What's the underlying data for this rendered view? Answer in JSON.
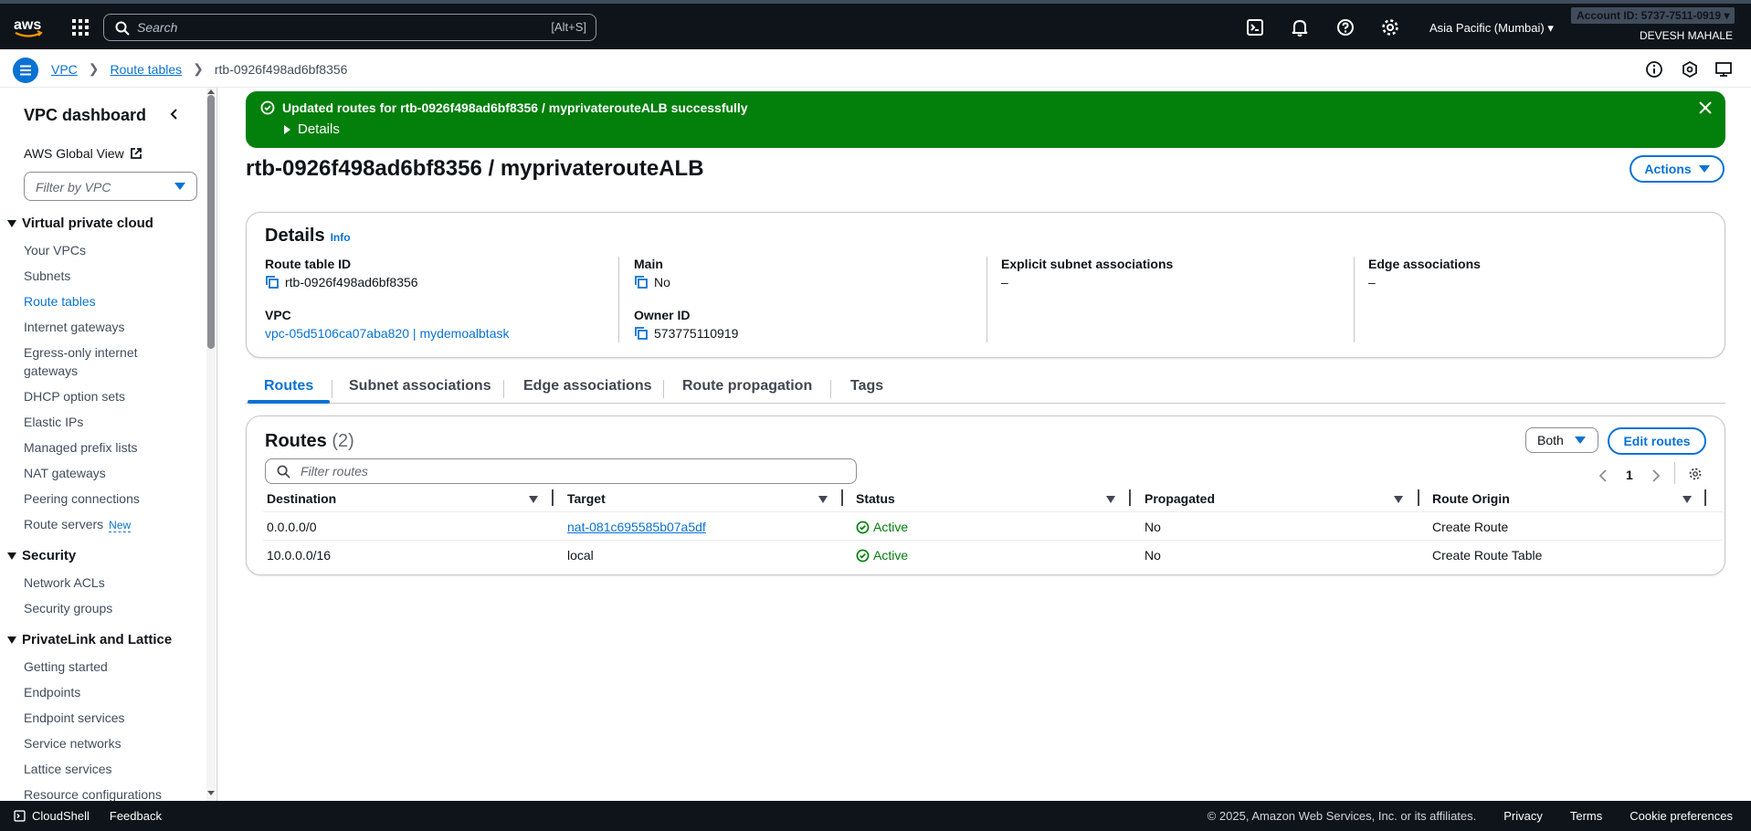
{
  "topnav": {
    "search_placeholder": "Search",
    "search_shortcut": "[Alt+S]",
    "region": "Asia Pacific (Mumbai)",
    "account_label": "Account ID: 5737-7511-0919",
    "username": "DEVESH MAHALE"
  },
  "breadcrumb": {
    "items": [
      "VPC",
      "Route tables"
    ],
    "current": "rtb-0926f498ad6bf8356"
  },
  "sidebar": {
    "title": "VPC dashboard",
    "global_view": "AWS Global View",
    "filter_placeholder": "Filter by VPC",
    "sections": [
      {
        "title": "Virtual private cloud",
        "items": [
          "Your VPCs",
          "Subnets",
          "Route tables",
          "Internet gateways",
          "Egress-only internet gateways",
          "DHCP option sets",
          "Elastic IPs",
          "Managed prefix lists",
          "NAT gateways",
          "Peering connections",
          "Route servers"
        ]
      },
      {
        "title": "Security",
        "items": [
          "Network ACLs",
          "Security groups"
        ]
      },
      {
        "title": "PrivateLink and Lattice",
        "items": [
          "Getting started",
          "Endpoints",
          "Endpoint services",
          "Service networks",
          "Lattice services",
          "Resource configurations"
        ]
      }
    ],
    "new_badge": "New"
  },
  "flash": {
    "message": "Updated routes for rtb-0926f498ad6bf8356 / myprivaterouteALB successfully",
    "details_label": "Details"
  },
  "page": {
    "title": "rtb-0926f498ad6bf8356 / myprivaterouteALB",
    "actions_label": "Actions"
  },
  "details": {
    "title": "Details",
    "info": "Info",
    "route_table_id_label": "Route table ID",
    "route_table_id": "rtb-0926f498ad6bf8356",
    "main_label": "Main",
    "main": "No",
    "explicit_label": "Explicit subnet associations",
    "explicit": "–",
    "edge_label": "Edge associations",
    "edge": "–",
    "vpc_label": "VPC",
    "vpc": "vpc-05d5106ca07aba820 | mydemoalbtask",
    "owner_label": "Owner ID",
    "owner": "573775110919"
  },
  "tabs": [
    "Routes",
    "Subnet associations",
    "Edge associations",
    "Route propagation",
    "Tags"
  ],
  "routes": {
    "title": "Routes",
    "count": "(2)",
    "filter_placeholder": "Filter routes",
    "both_label": "Both",
    "edit_label": "Edit routes",
    "page": "1",
    "columns": [
      "Destination",
      "Target",
      "Status",
      "Propagated",
      "Route Origin"
    ],
    "rows": [
      {
        "destination": "0.0.0.0/0",
        "target": "nat-081c695585b07a5df",
        "status": "Active",
        "propagated": "No",
        "origin": "Create Route"
      },
      {
        "destination": "10.0.0.0/16",
        "target": "local",
        "status": "Active",
        "propagated": "No",
        "origin": "Create Route Table"
      }
    ]
  },
  "footer": {
    "cloudshell": "CloudShell",
    "feedback": "Feedback",
    "copyright": "© 2025, Amazon Web Services, Inc. or its affiliates.",
    "privacy": "Privacy",
    "terms": "Terms",
    "cookies": "Cookie preferences"
  },
  "colors": {
    "nav_bg": "#0f141a",
    "link": "#0972d3",
    "success": "#037f0c"
  },
  "icons": [
    "aws-logo",
    "app-grid-icon",
    "search-icon",
    "cloudshell-icon",
    "bell-icon",
    "help-icon",
    "gear-icon",
    "menu-icon",
    "info-icon",
    "settings-icon",
    "display-icon",
    "external-link-icon",
    "copy-icon",
    "check-circle-icon",
    "close-icon"
  ]
}
